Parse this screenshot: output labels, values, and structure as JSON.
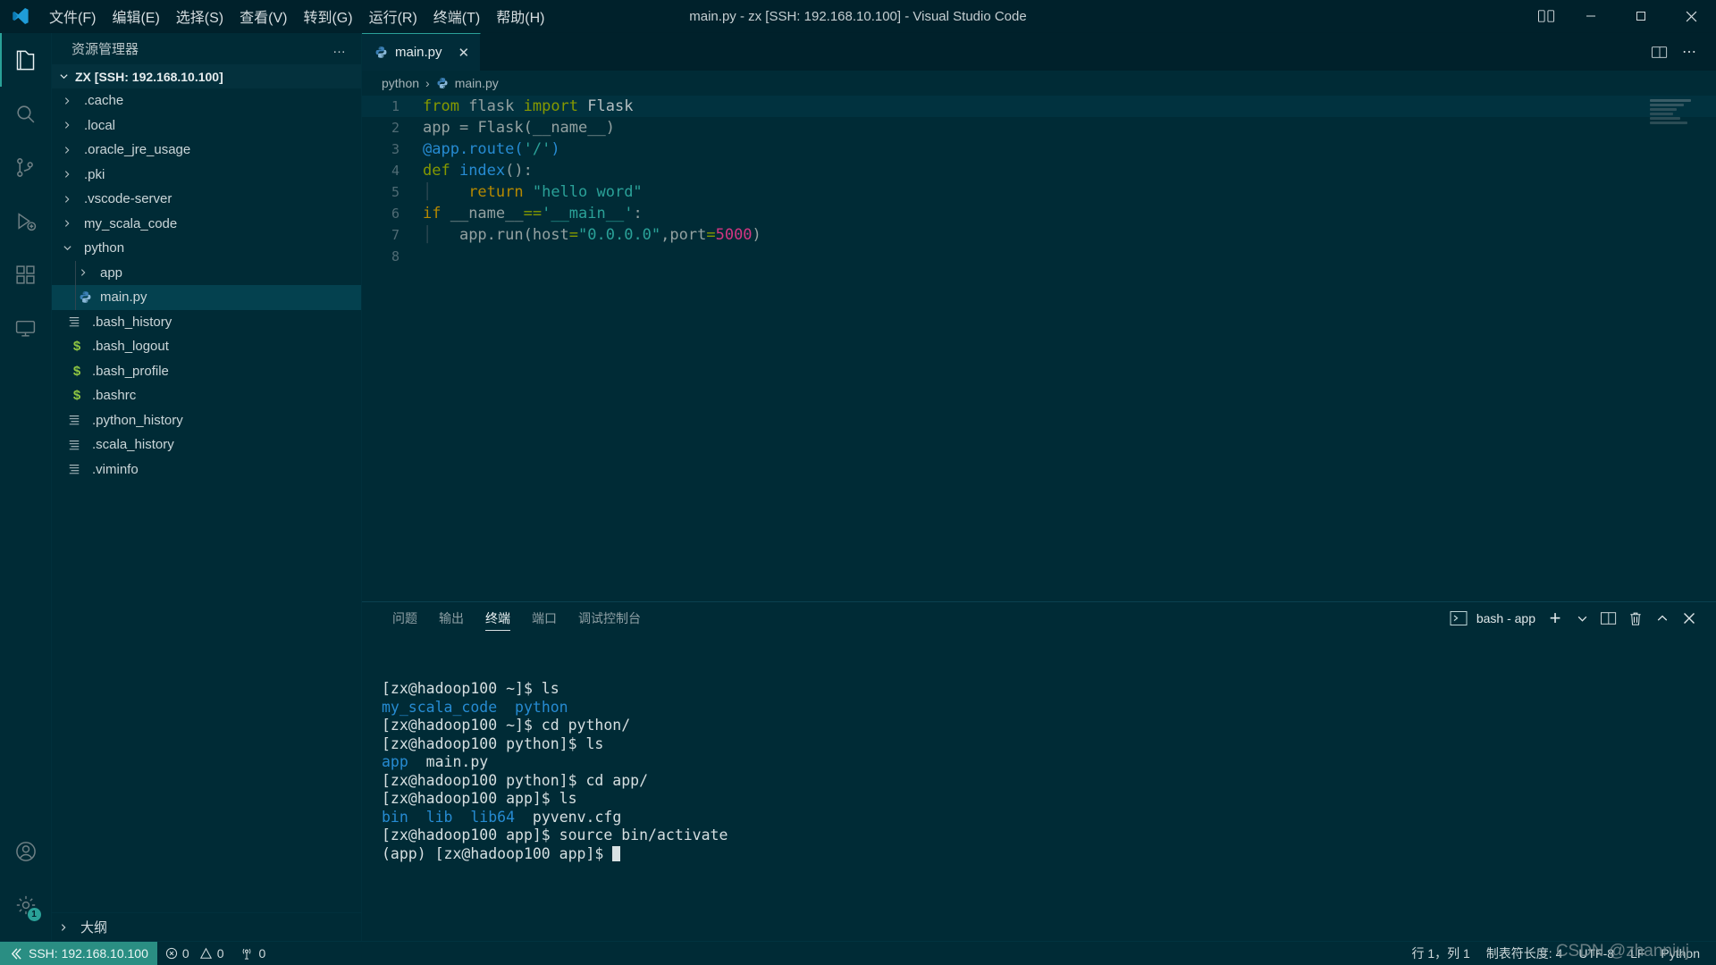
{
  "window": {
    "title": "main.py - zx [SSH: 192.168.10.100] - Visual Studio Code",
    "minimize_label": "─",
    "maximize_label": "❐",
    "close_label": "✕"
  },
  "menu": {
    "items": [
      {
        "label": "文件(F)",
        "name": "menu-file"
      },
      {
        "label": "编辑(E)",
        "name": "menu-edit"
      },
      {
        "label": "选择(S)",
        "name": "menu-selection"
      },
      {
        "label": "查看(V)",
        "name": "menu-view"
      },
      {
        "label": "转到(G)",
        "name": "menu-go"
      },
      {
        "label": "运行(R)",
        "name": "menu-run"
      },
      {
        "label": "终端(T)",
        "name": "menu-terminal"
      },
      {
        "label": "帮助(H)",
        "name": "menu-help"
      }
    ]
  },
  "activitybar": {
    "items": [
      {
        "name": "explorer",
        "icon": "files-icon",
        "active": true
      },
      {
        "name": "search",
        "icon": "search-icon",
        "active": false
      },
      {
        "name": "source-control",
        "icon": "source-control-icon",
        "active": false
      },
      {
        "name": "run-debug",
        "icon": "run-debug-icon",
        "active": false
      },
      {
        "name": "extensions",
        "icon": "extensions-icon",
        "active": false
      },
      {
        "name": "remote-explorer",
        "icon": "remote-explorer-icon",
        "active": false
      }
    ],
    "bottom": [
      {
        "name": "accounts",
        "icon": "account-icon"
      },
      {
        "name": "manage",
        "icon": "gear-icon",
        "badge": "1"
      }
    ]
  },
  "sidebar": {
    "header_title": "资源管理器",
    "more_actions": "…",
    "root_label": "ZX [SSH: 192.168.10.100]",
    "outline_label": "大纲",
    "tree": [
      {
        "label": ".cache",
        "type": "folder",
        "expanded": false,
        "depth": 1
      },
      {
        "label": ".local",
        "type": "folder",
        "expanded": false,
        "depth": 1
      },
      {
        "label": ".oracle_jre_usage",
        "type": "folder",
        "expanded": false,
        "depth": 1
      },
      {
        "label": ".pki",
        "type": "folder",
        "expanded": false,
        "depth": 1
      },
      {
        "label": ".vscode-server",
        "type": "folder",
        "expanded": false,
        "depth": 1
      },
      {
        "label": "my_scala_code",
        "type": "folder",
        "expanded": false,
        "depth": 1
      },
      {
        "label": "python",
        "type": "folder",
        "expanded": true,
        "depth": 1
      },
      {
        "label": "app",
        "type": "folder",
        "expanded": false,
        "depth": 2
      },
      {
        "label": "main.py",
        "type": "python",
        "selected": true,
        "depth": 2
      },
      {
        "label": ".bash_history",
        "type": "lines",
        "depth": 1
      },
      {
        "label": ".bash_logout",
        "type": "shell",
        "depth": 1
      },
      {
        "label": ".bash_profile",
        "type": "shell",
        "depth": 1
      },
      {
        "label": ".bashrc",
        "type": "shell",
        "depth": 1
      },
      {
        "label": ".python_history",
        "type": "lines",
        "depth": 1
      },
      {
        "label": ".scala_history",
        "type": "lines",
        "depth": 1
      },
      {
        "label": ".viminfo",
        "type": "lines",
        "depth": 1
      }
    ]
  },
  "editor": {
    "tab_label": "main.py",
    "tab_close": "✕",
    "breadcrumb": [
      "python",
      "main.py"
    ],
    "breadcrumb_sep": "›",
    "lines": [
      {
        "n": "1",
        "active": true,
        "tokens": [
          {
            "t": "from ",
            "c": "t-kw"
          },
          {
            "t": "flask ",
            "c": "t-plain"
          },
          {
            "t": "import ",
            "c": "t-kw"
          },
          {
            "t": "Flask",
            "c": "t-cls"
          }
        ]
      },
      {
        "n": "2",
        "active": false,
        "tokens": [
          {
            "t": "app ",
            "c": "t-plain"
          },
          {
            "t": "= ",
            "c": "t-plain"
          },
          {
            "t": "Flask(__name__)",
            "c": "t-plain"
          }
        ]
      },
      {
        "n": "3",
        "active": false,
        "tokens": [
          {
            "t": "@app.route(",
            "c": "t-dec"
          },
          {
            "t": "'/'",
            "c": "t-str"
          },
          {
            "t": ")",
            "c": "t-dec"
          }
        ]
      },
      {
        "n": "4",
        "active": false,
        "tokens": [
          {
            "t": "def ",
            "c": "t-kw"
          },
          {
            "t": "index",
            "c": "t-fn"
          },
          {
            "t": "():",
            "c": "t-plain"
          }
        ]
      },
      {
        "n": "5",
        "active": false,
        "guide": true,
        "tokens": [
          {
            "t": "    return ",
            "c": "t-kw2"
          },
          {
            "t": "\"hello word\"",
            "c": "t-str"
          }
        ]
      },
      {
        "n": "6",
        "active": false,
        "tokens": [
          {
            "t": "if ",
            "c": "t-kw2"
          },
          {
            "t": "__name__",
            "c": "t-plain"
          },
          {
            "t": "==",
            "c": "t-op"
          },
          {
            "t": "'__main__'",
            "c": "t-str"
          },
          {
            "t": ":",
            "c": "t-plain"
          }
        ]
      },
      {
        "n": "7",
        "active": false,
        "guide": true,
        "tokens": [
          {
            "t": "   app.run(host",
            "c": "t-plain"
          },
          {
            "t": "=",
            "c": "t-op"
          },
          {
            "t": "\"0.0.0.0\"",
            "c": "t-str"
          },
          {
            "t": ",port",
            "c": "t-plain"
          },
          {
            "t": "=",
            "c": "t-op"
          },
          {
            "t": "5000",
            "c": "t-num"
          },
          {
            "t": ")",
            "c": "t-plain"
          }
        ]
      },
      {
        "n": "8",
        "active": false,
        "tokens": []
      }
    ]
  },
  "panel": {
    "tabs": [
      {
        "label": "问题",
        "name": "tab-problems",
        "active": false
      },
      {
        "label": "输出",
        "name": "tab-output",
        "active": false
      },
      {
        "label": "终端",
        "name": "tab-terminal",
        "active": true
      },
      {
        "label": "端口",
        "name": "tab-ports",
        "active": false
      },
      {
        "label": "调试控制台",
        "name": "tab-debug-console",
        "active": false
      }
    ],
    "terminal_selector": "bash - app",
    "actions": {
      "new": "+",
      "dropdown": "⌄",
      "split": "split-icon",
      "kill": "trash-icon",
      "maximize": "⌃",
      "close": "✕"
    },
    "terminal_lines": [
      [
        {
          "t": "[zx@hadoop100 ~]$ ls",
          "c": ""
        }
      ],
      [
        {
          "t": "my_scala_code",
          "c": "tt-dir"
        },
        {
          "t": "  "
        },
        {
          "t": "python",
          "c": "tt-dir"
        }
      ],
      [
        {
          "t": "[zx@hadoop100 ~]$ cd python/",
          "c": ""
        }
      ],
      [
        {
          "t": "[zx@hadoop100 python]$ ls",
          "c": ""
        }
      ],
      [
        {
          "t": "app",
          "c": "tt-dir"
        },
        {
          "t": "  main.py"
        }
      ],
      [
        {
          "t": "[zx@hadoop100 python]$ cd app/",
          "c": ""
        }
      ],
      [
        {
          "t": "[zx@hadoop100 app]$ ls",
          "c": ""
        }
      ],
      [
        {
          "t": "bin",
          "c": "tt-dir"
        },
        {
          "t": "  "
        },
        {
          "t": "lib",
          "c": "tt-dir"
        },
        {
          "t": "  "
        },
        {
          "t": "lib64",
          "c": "tt-dir"
        },
        {
          "t": "  pyvenv.cfg"
        }
      ],
      [
        {
          "t": "[zx@hadoop100 app]$ source bin/activate",
          "c": ""
        }
      ],
      [
        {
          "t": "(app) [zx@hadoop100 app]$ ",
          "c": ""
        }
      ]
    ]
  },
  "statusbar": {
    "remote_label": "SSH: 192.168.10.100",
    "errors": "0",
    "warnings": "0",
    "radio_tower": "0",
    "cursor_position": "行 1，列 1",
    "tab_size": "制表符长度: 4",
    "encoding": "UTF-8",
    "eol": "LF",
    "language": "Python"
  },
  "watermark": "CSDN @zhanniuj",
  "colors": {
    "accent": "#2aa198",
    "background": "#002b36",
    "titlebar": "#00212b",
    "remote_badge": "#2a8e83",
    "string": "#2aa198",
    "keyword": "#859900",
    "number": "#d33682",
    "function": "#268bd2"
  }
}
